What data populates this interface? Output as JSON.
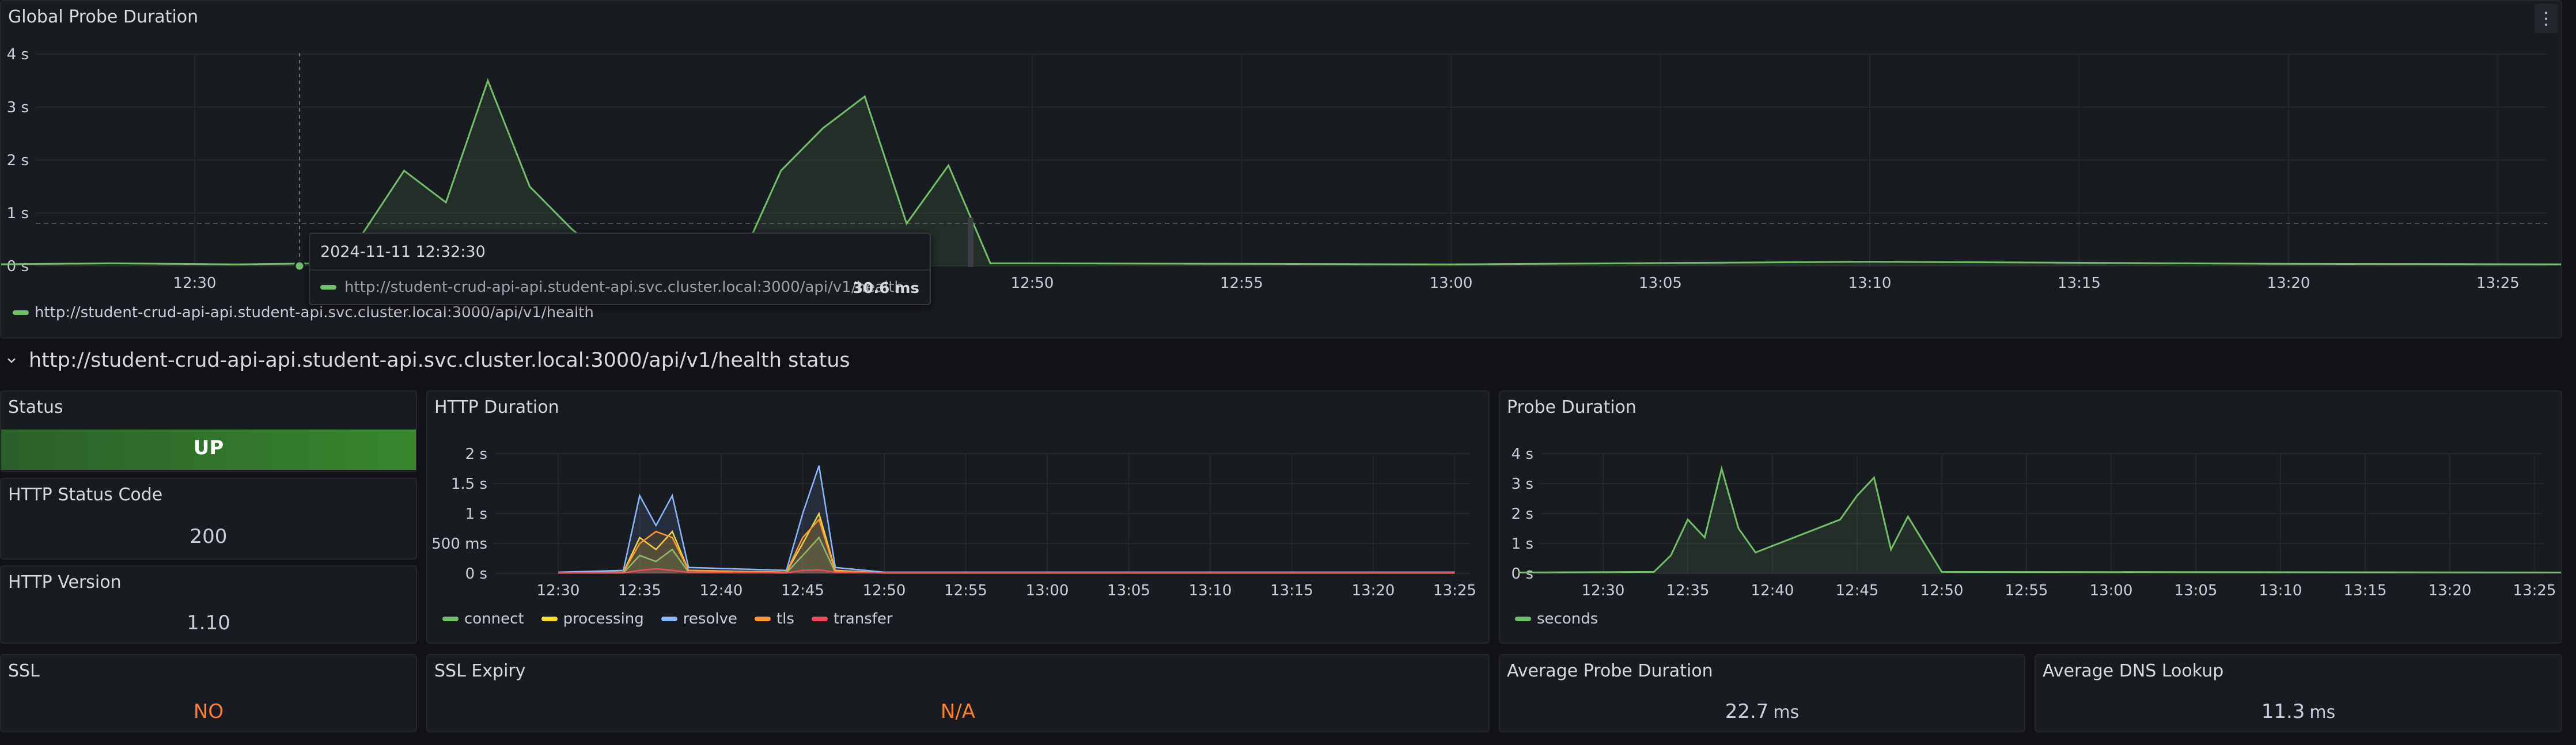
{
  "global_panel": {
    "title": "Global Probe Duration",
    "menu_icon": "kebab-menu-icon",
    "legend": "http://student-crud-api-api.student-api.svc.cluster.local:3000/api/v1/health",
    "y_ticks": [
      "4 s",
      "3 s",
      "2 s",
      "1 s",
      "0 s"
    ],
    "x_ticks": [
      "12:30",
      "12:50",
      "12:55",
      "13:00",
      "13:05",
      "13:10",
      "13:15",
      "13:20",
      "13:25"
    ],
    "color": "#73bf69"
  },
  "tooltip": {
    "timestamp": "2024-11-11 12:32:30",
    "series": "http://student-crud-api-api.student-api.svc.cluster.local:3000/api/v1/health",
    "value": "30.6 ms"
  },
  "row": {
    "title": "http://student-crud-api-api.student-api.svc.cluster.local:3000/api/v1/health status",
    "chevron_icon": "chevron-down-icon"
  },
  "status": {
    "title": "Status",
    "value": "UP",
    "bg_color": "#37872d"
  },
  "http_status_code": {
    "title": "HTTP Status Code",
    "value": "200"
  },
  "http_version": {
    "title": "HTTP Version",
    "value": "1.10"
  },
  "ssl": {
    "title": "SSL",
    "value": "NO",
    "color": "#ff7f2e"
  },
  "ssl_expiry": {
    "title": "SSL Expiry",
    "value": "N/A",
    "color": "#ff7f2e"
  },
  "http_duration": {
    "title": "HTTP Duration",
    "y_ticks": [
      "2 s",
      "1.5 s",
      "1 s",
      "500 ms",
      "0 s"
    ],
    "x_ticks": [
      "12:30",
      "12:35",
      "12:40",
      "12:45",
      "12:50",
      "12:55",
      "13:00",
      "13:05",
      "13:10",
      "13:15",
      "13:20",
      "13:25"
    ],
    "legend": [
      {
        "name": "connect",
        "color": "#73bf69"
      },
      {
        "name": "processing",
        "color": "#fade2a"
      },
      {
        "name": "resolve",
        "color": "#8ab8ff"
      },
      {
        "name": "tls",
        "color": "#ff9830"
      },
      {
        "name": "transfer",
        "color": "#f2495c"
      }
    ]
  },
  "probe_duration": {
    "title": "Probe Duration",
    "y_ticks": [
      "4 s",
      "3 s",
      "2 s",
      "1 s",
      "0 s"
    ],
    "x_ticks": [
      "12:30",
      "12:35",
      "12:40",
      "12:45",
      "12:50",
      "12:55",
      "13:00",
      "13:05",
      "13:10",
      "13:15",
      "13:20",
      "13:25"
    ],
    "legend": "seconds",
    "color": "#73bf69"
  },
  "avg_probe": {
    "title": "Average Probe Duration",
    "value": "22.7",
    "unit": "ms"
  },
  "avg_dns": {
    "title": "Average DNS Lookup",
    "value": "11.3",
    "unit": "ms"
  },
  "chart_data": [
    {
      "type": "line",
      "title": "Global Probe Duration",
      "ylim": [
        0,
        4
      ],
      "x": [
        "12:25",
        "12:28",
        "12:31",
        "12:33",
        "12:34",
        "12:35",
        "12:36",
        "12:37",
        "12:38",
        "12:39",
        "12:40",
        "12:41",
        "12:42",
        "12:43",
        "12:44",
        "12:45",
        "12:46",
        "12:47",
        "12:48",
        "12:49",
        "12:50",
        "13:00",
        "13:10",
        "13:20",
        "13:27"
      ],
      "series": [
        {
          "name": "http://student-crud-api-api.student-api.svc.cluster.local:3000/api/v1/health",
          "values": [
            0.03,
            0.05,
            0.03,
            0.05,
            0.6,
            1.8,
            1.2,
            3.5,
            1.5,
            0.7,
            0.05,
            0.05,
            0.05,
            0.05,
            1.8,
            2.6,
            3.2,
            0.8,
            1.9,
            0.05,
            0.05,
            0.03,
            0.08,
            0.04,
            0.03
          ]
        }
      ]
    },
    {
      "type": "line",
      "title": "HTTP Duration",
      "ylim": [
        0,
        2
      ],
      "x": [
        "12:30",
        "12:34",
        "12:35",
        "12:36",
        "12:37",
        "12:38",
        "12:44",
        "12:45",
        "12:46",
        "12:47",
        "12:50",
        "13:25"
      ],
      "series": [
        {
          "name": "connect",
          "values": [
            0.01,
            0.01,
            0.3,
            0.2,
            0.4,
            0.02,
            0.01,
            0.3,
            0.6,
            0.02,
            0.01,
            0.01
          ]
        },
        {
          "name": "processing",
          "values": [
            0.01,
            0.02,
            0.6,
            0.4,
            0.7,
            0.05,
            0.02,
            0.5,
            1.0,
            0.05,
            0.01,
            0.01
          ]
        },
        {
          "name": "resolve",
          "values": [
            0.02,
            0.05,
            1.3,
            0.8,
            1.3,
            0.1,
            0.05,
            1.0,
            1.8,
            0.1,
            0.02,
            0.02
          ]
        },
        {
          "name": "tls",
          "values": [
            0.01,
            0.02,
            0.5,
            0.7,
            0.6,
            0.05,
            0.02,
            0.6,
            0.9,
            0.04,
            0.01,
            0.01
          ]
        },
        {
          "name": "transfer",
          "values": [
            0.01,
            0.01,
            0.05,
            0.08,
            0.05,
            0.02,
            0.01,
            0.05,
            0.06,
            0.02,
            0.01,
            0.01
          ]
        }
      ]
    },
    {
      "type": "line",
      "title": "Probe Duration",
      "ylim": [
        0,
        4
      ],
      "x": [
        "12:25",
        "12:33",
        "12:34",
        "12:35",
        "12:36",
        "12:37",
        "12:38",
        "12:39",
        "12:44",
        "12:45",
        "12:46",
        "12:47",
        "12:48",
        "12:50",
        "13:27"
      ],
      "series": [
        {
          "name": "seconds",
          "values": [
            0.03,
            0.05,
            0.6,
            1.8,
            1.2,
            3.5,
            1.5,
            0.7,
            1.8,
            2.6,
            3.2,
            0.8,
            1.9,
            0.05,
            0.03
          ]
        }
      ]
    }
  ]
}
